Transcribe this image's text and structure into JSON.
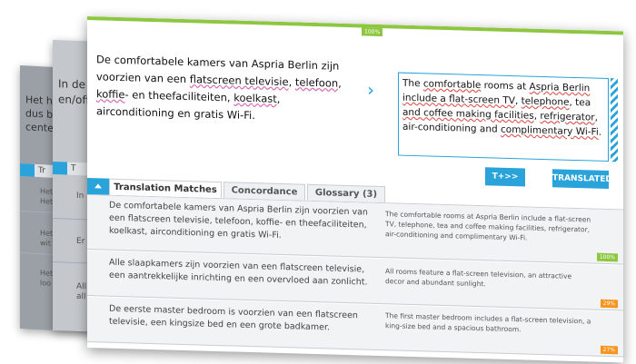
{
  "back_card": {
    "lines": [
      "Het ho",
      "dus be",
      "center"
    ],
    "tab_label": "Tr",
    "rows": [
      [
        "Het",
        "Het"
      ],
      [
        "Het",
        "wit"
      ],
      [
        "Het",
        "loo"
      ]
    ]
  },
  "mid_card": {
    "lines": [
      "In de",
      "en/ofi"
    ],
    "tab_label": "T",
    "rows": [
      [
        "In"
      ],
      [
        "Er"
      ],
      [
        "All",
        "all"
      ]
    ]
  },
  "editor": {
    "progress_percent": 100,
    "progress_label": "100%",
    "source_parts": [
      {
        "t": "De comfortabele kamers van Aspria Berlin zijn voorzien van een ",
        "u": false
      },
      {
        "t": "flatscreen televisie",
        "u": true
      },
      {
        "t": ", ",
        "u": false
      },
      {
        "t": "telefoon",
        "u": true
      },
      {
        "t": ", ",
        "u": false
      },
      {
        "t": "koffie",
        "u": true
      },
      {
        "t": "- en theefaciliteiten, ",
        "u": false
      },
      {
        "t": "koelkast",
        "u": true
      },
      {
        "t": ", airconditioning en gratis Wi-Fi.",
        "u": false
      }
    ],
    "target_parts": [
      {
        "t": "The ",
        "u": false
      },
      {
        "t": "comfortable",
        "u": true
      },
      {
        "t": " rooms at ",
        "u": false
      },
      {
        "t": "Aspria Berlin",
        "u": true
      },
      {
        "t": " ",
        "u": false
      },
      {
        "t": "include a flat-screen TV",
        "u": true
      },
      {
        "t": ", ",
        "u": false
      },
      {
        "t": "telephone",
        "u": true
      },
      {
        "t": ", tea ",
        "u": false
      },
      {
        "t": "and coffee making facilities",
        "u": true
      },
      {
        "t": ", ",
        "u": false
      },
      {
        "t": "refrigerator",
        "u": true
      },
      {
        "t": ", air-conditioning and ",
        "u": false
      },
      {
        "t": "complimentary Wi-Fi",
        "u": true
      },
      {
        "t": ".",
        "u": false
      }
    ],
    "buttons": {
      "t_plus": "T+>>",
      "translated": "TRANSLATED"
    },
    "accent_color": "#29a3d9",
    "match_color": "#8dc63f",
    "fuzzy_color": "#f7941d"
  },
  "tabs": {
    "translation_matches": "Translation Matches",
    "concordance": "Concordance",
    "glossary": "Glossary (3)"
  },
  "matches": [
    {
      "source": "De comfortabele kamers van Aspria Berlin zijn voorzien van een flatscreen televisie, telefoon, koffie- en theefaciliteiten, koelkast, airconditioning en gratis Wi-Fi.",
      "target": "The comfortable rooms at Aspria Berlin include a flat-screen TV, telephone, tea and coffee making facilities, refrigerator, air-conditioning and complimentary Wi-Fi.",
      "score": "100%"
    },
    {
      "source": "Alle slaapkamers zijn voorzien van een flatscreen televisie, een aantrekkelijke inrichting en een overvloed aan zonlicht.",
      "target": "All rooms feature a flat-screen television, an attractive decor and abundant sunlight.",
      "score": "29%"
    },
    {
      "source": "De eerste master bedroom is voorzien van een flatscreen televisie, een kingsize bed en een grote badkamer.",
      "target": "The first master bedroom includes a flat-screen television, a king-size bed and a spacious bathroom.",
      "score": "27%"
    }
  ]
}
